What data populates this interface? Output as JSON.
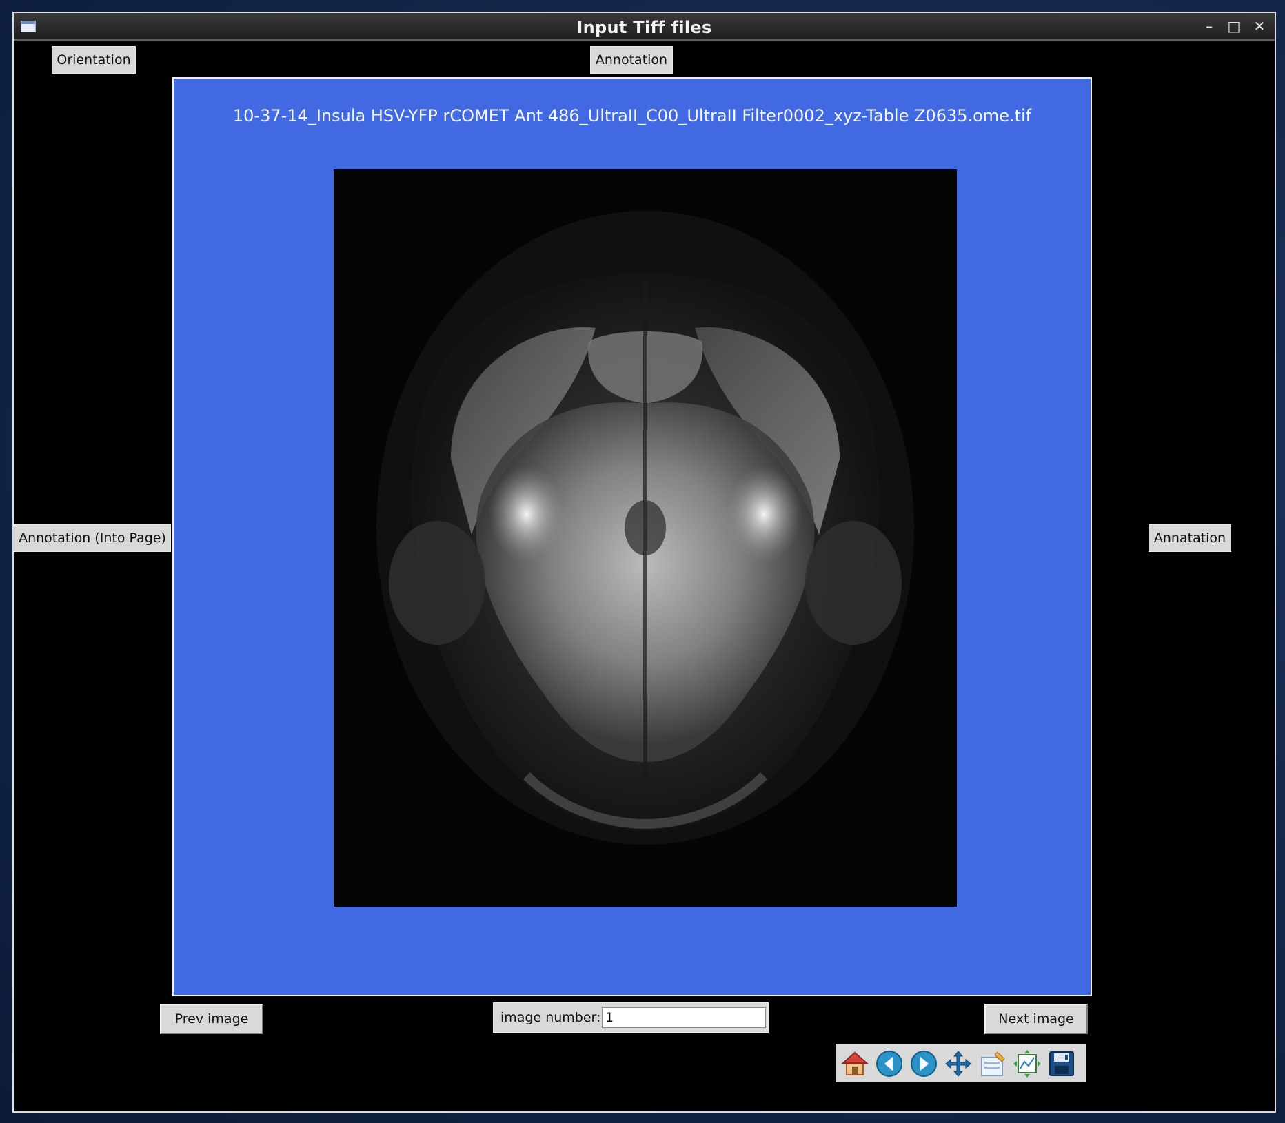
{
  "window": {
    "title": "Input Tiff files"
  },
  "buttons": {
    "orientation": "Orientation",
    "annotation_top": "Annotation",
    "annotation_left": "Annotation (Into Page)",
    "annotation_right": "Annatation",
    "prev": "Prev image",
    "next": "Next image"
  },
  "figure": {
    "title": "10-37-14_Insula HSV-YFP rCOMET Ant 486_UltraII_C00_UltraII Filter0002_xyz-Table Z0635.ome.tif"
  },
  "image_number": {
    "label": "image number:",
    "value": "1"
  },
  "toolbar": {
    "icons": [
      "home-icon",
      "back-icon",
      "forward-icon",
      "pan-icon",
      "configure-subplots-icon",
      "edit-axis-icon",
      "save-icon"
    ]
  },
  "colors": {
    "figure_background": "#4169e1",
    "window_background": "#000000"
  }
}
